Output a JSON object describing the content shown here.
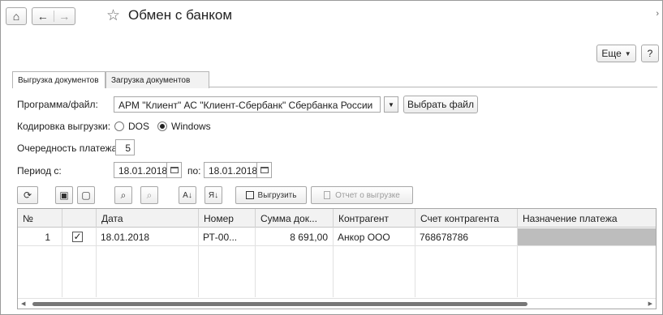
{
  "window": {
    "title": "Обмен с банком",
    "close_glyph": "›"
  },
  "nav": {
    "home_icon": "⌂",
    "back_icon": "←",
    "forward_icon": "→",
    "favorite_icon": "☆"
  },
  "topright": {
    "more_label": "Еще",
    "help_label": "?"
  },
  "tabs": [
    {
      "label": "Выгрузка документов",
      "active": true
    },
    {
      "label": "Загрузка документов",
      "active": false
    }
  ],
  "form": {
    "program_label": "Программа/файл:",
    "program_value": "АРМ \"Клиент\" АС \"Клиент-Сбербанк\" Сбербанка России",
    "choose_file_label": "Выбрать файл",
    "encoding_label": "Кодировка выгрузки:",
    "encoding_options": [
      "DOS",
      "Windows"
    ],
    "encoding_selected": "Windows",
    "priority_label": "Очередность платежа:",
    "priority_value": "5",
    "period_label": "Период с:",
    "period_from": "18.01.2018",
    "period_to_label": "по:",
    "period_to": "18.01.2018"
  },
  "toolbar": {
    "refresh_icon": "⟳",
    "select_all_icon": "▣",
    "deselect_all_icon": "▢",
    "search_icon": "⌕",
    "cancel_search_icon": "⌕",
    "sort_asc_icon": "A↓",
    "sort_desc_icon": "Я↓",
    "export_label": "Выгрузить",
    "report_label": "Отчет о выгрузке"
  },
  "table": {
    "columns": [
      "№",
      "",
      "Дата",
      "Номер",
      "Сумма док...",
      "Контрагент",
      "Счет контрагента",
      "Назначение платежа"
    ],
    "rows": [
      {
        "num": "1",
        "checked": true,
        "date": "18.01.2018",
        "number": "РТ-00...",
        "sum": "8 691,00",
        "counterparty": "Анкор ООО",
        "account": "768678786",
        "purpose": ""
      }
    ]
  }
}
